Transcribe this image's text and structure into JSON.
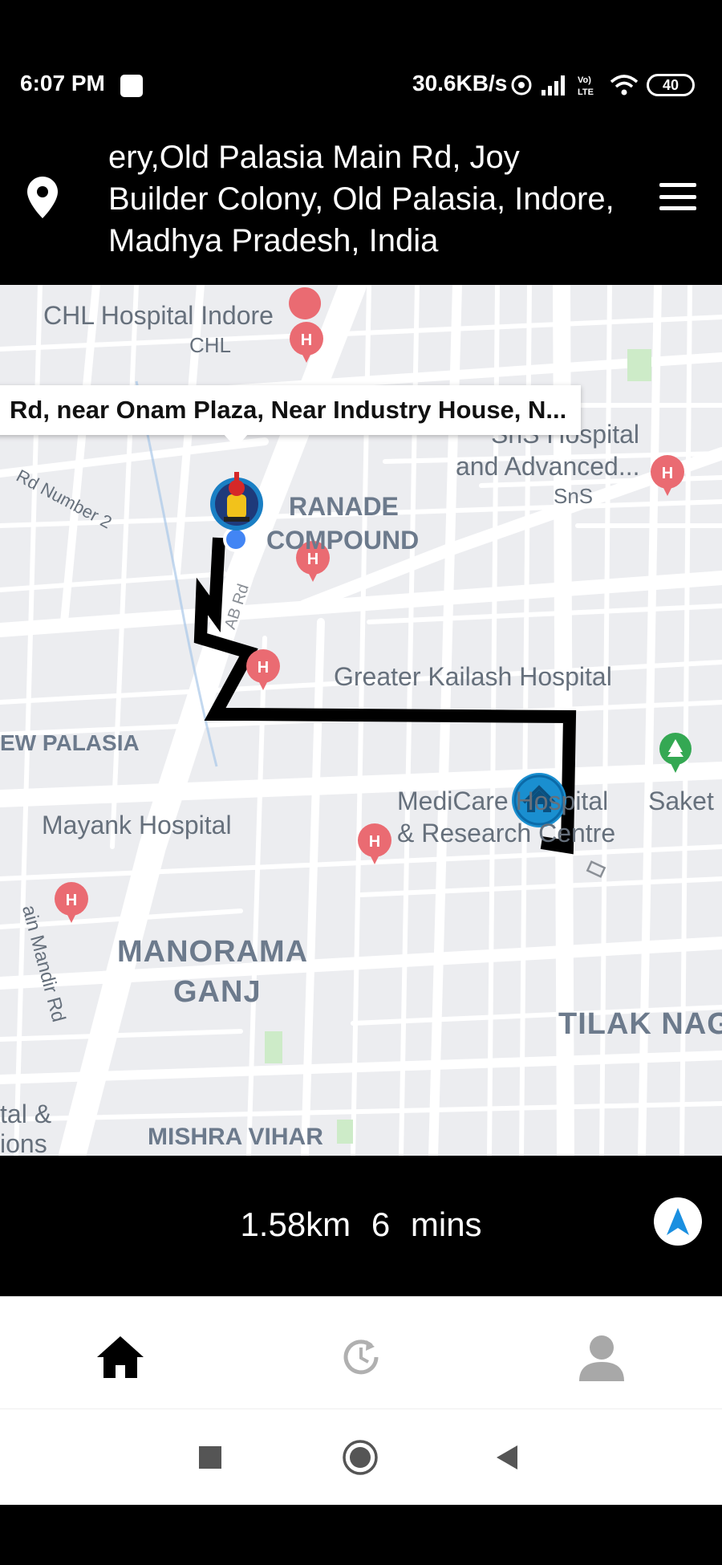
{
  "status_bar": {
    "time": "6:07 PM",
    "net_speed": "30.6KB/s",
    "volte": "Vo) LTE",
    "battery": "40"
  },
  "header": {
    "address": "ery,Old Palasia Main Rd, Joy Builder Colony, Old Palasia, Indore, Madhya Pradesh, India",
    "location_icon": "location-pin-icon",
    "menu_icon": "hamburger-menu-icon"
  },
  "map": {
    "callout": "Rd, near Onam Plaza, Near Industry House, N...",
    "labels": {
      "chl_hospital": "CHL Hospital Indore",
      "chl": "CHL",
      "sns_hospital": "SnS Hospital",
      "sns_advanced": "and Advanced...",
      "sns": "SnS",
      "rd_number_2": "Rd Number 2",
      "ranade": "RANADE",
      "compound": "COMPOUND",
      "greater_kailash": "Greater Kailash Hospital",
      "new_palasia": "EW PALASIA",
      "medicare_1": "MediCare Hospital",
      "medicare_2": "& Research Centre",
      "saket": "Saket C",
      "mayank": "Mayank Hospital",
      "manorama": "MANORAMA",
      "ganj": "GANJ",
      "tilak_nagar": "TILAK NAG",
      "jain_mandir": "ain Mandir Rd",
      "mishra_vihar": "MISHRA VIHAR",
      "tal_1": "tal &",
      "tal_2": "ions",
      "ab_road": "AB Rd"
    },
    "colors": {
      "route": "#000000",
      "hospital_pin": "#ea6b72",
      "park_pin": "#34a853",
      "current_location": "#4285f4",
      "home_marker": "#1a8fd0"
    }
  },
  "route": {
    "distance": "1.58km",
    "duration": "6 mins"
  },
  "tabs": [
    {
      "name": "home",
      "icon": "home-icon",
      "active": true
    },
    {
      "name": "history",
      "icon": "history-icon",
      "active": false
    },
    {
      "name": "profile",
      "icon": "profile-icon",
      "active": false
    }
  ],
  "system_nav": [
    "recents-square-icon",
    "home-circle-icon",
    "back-triangle-icon"
  ]
}
